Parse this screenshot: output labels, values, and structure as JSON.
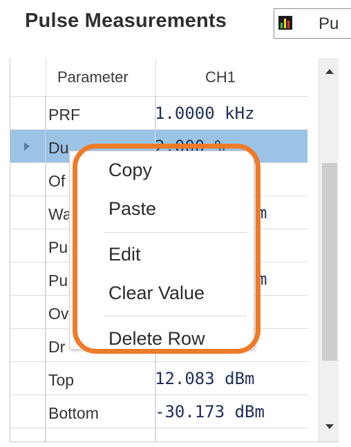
{
  "panel": {
    "title": "Pulse Measurements",
    "toolbox_icon": "chart-bars-icon",
    "toolbox_label": "Pu"
  },
  "grid": {
    "headers": [
      "Parameter",
      "CH1"
    ],
    "rows": [
      {
        "parameter": "PRF",
        "value": "1.0000 kHz",
        "selected": false
      },
      {
        "parameter": "Du",
        "value": "2.000 %",
        "selected": true
      },
      {
        "parameter": "Of",
        "value": "",
        "selected": false
      },
      {
        "parameter": "Wa",
        "value": "m",
        "selected": false
      },
      {
        "parameter": "Pu",
        "value": "",
        "selected": false
      },
      {
        "parameter": "Pu",
        "value": "m",
        "selected": false
      },
      {
        "parameter": "Ov",
        "value": "",
        "selected": false
      },
      {
        "parameter": "Dr",
        "value": "",
        "selected": false
      },
      {
        "parameter": "Top",
        "value": "12.083 dBm",
        "selected": false
      },
      {
        "parameter": "Bottom",
        "value": "-30.173 dBm",
        "selected": false
      },
      {
        "parameter": "",
        "value": "",
        "selected": false
      }
    ],
    "selection_icon": "row-selector-arrow-icon",
    "scroll_up_icon": "scroll-up-arrow-icon",
    "scroll_down_icon": "scroll-down-arrow-icon"
  },
  "context_menu": {
    "items": [
      "Copy",
      "Paste",
      "Edit",
      "Clear Value",
      "Delete Row"
    ],
    "highlight_color": "#f07a28"
  },
  "colors": {
    "selected_row": "#9bc3e6",
    "value_text": "#1f2f5a"
  }
}
